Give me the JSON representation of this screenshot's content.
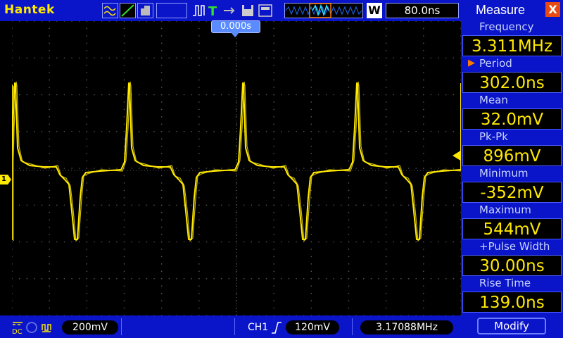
{
  "app": {
    "brand": "Hantek"
  },
  "toolbar": {
    "timebase": "80.0ns",
    "window_label": "W"
  },
  "trigger_marker": {
    "time": "0.000s"
  },
  "plot": {
    "channel_marker": "1",
    "trace_color": "#ffe900",
    "grid_color": "#5a5a5a",
    "chart_data": {
      "type": "line",
      "series": [
        {
          "values_note": "",
          "period_us": 0.302
        }
      ],
      "xlim": [
        -0.264,
        0.264
      ]
    }
  },
  "measure": {
    "title": "Measure",
    "close_label": "X",
    "items": [
      {
        "label": "Frequency",
        "value": "3.311MHz"
      },
      {
        "label": "Period",
        "value": "302.0ns",
        "selected": true
      },
      {
        "label": "Mean",
        "value": "32.0mV"
      },
      {
        "label": "Pk-Pk",
        "value": "896mV"
      },
      {
        "label": "Minimum",
        "value": "-352mV"
      },
      {
        "label": "Maximum",
        "value": "544mV"
      },
      {
        "label": "+Pulse Width",
        "value": "30.00ns"
      },
      {
        "label": "Rise Time",
        "value": "139.0ns"
      }
    ],
    "modify_label": "Modify"
  },
  "status": {
    "ch_scale": "200mV",
    "coupling": "DC",
    "trig_channel": "CH1",
    "trig_level": "120mV",
    "freq_counter": "3.17088MHz"
  }
}
